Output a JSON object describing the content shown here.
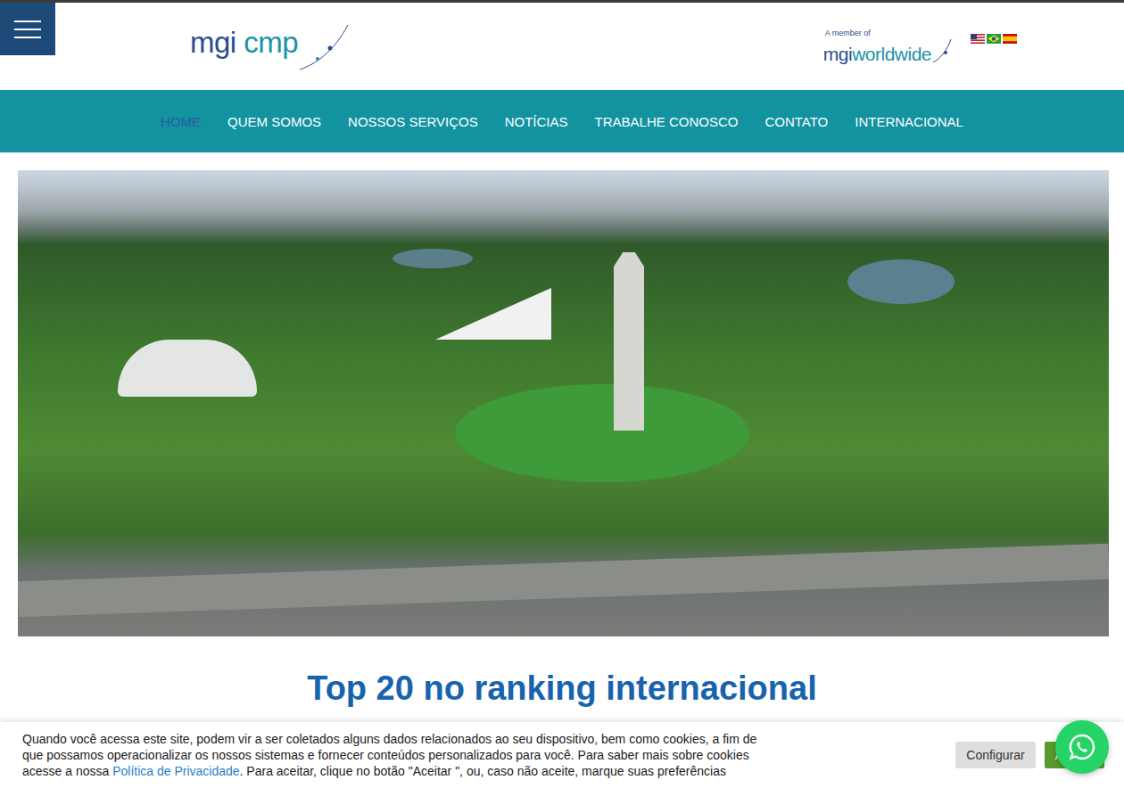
{
  "logo": {
    "part1": "mgi",
    "part2": "cmp"
  },
  "member": {
    "caption": "A member of",
    "part1": "mgi",
    "part2": "worldwide"
  },
  "nav": [
    {
      "label": "HOME",
      "selected": true
    },
    {
      "label": "QUEM SOMOS",
      "selected": false
    },
    {
      "label": "NOSSOS SERVIÇOS",
      "selected": false
    },
    {
      "label": "NOTÍCIAS",
      "selected": false
    },
    {
      "label": "TRABALHE CONOSCO",
      "selected": false
    },
    {
      "label": "CONTATO",
      "selected": false
    },
    {
      "label": "INTERNACIONAL",
      "selected": false
    }
  ],
  "heading": "Top 20 no ranking internacional",
  "cookie": {
    "text_before": "Quando você acessa este site, podem vir a ser coletados alguns dados relacionados ao seu dispositivo, bem como cookies, a fim de que possamos operacionalizar os nossos sistemas e fornecer conteúdos personalizados para você. Para saber mais sobre cookies acesse a nossa ",
    "link": "Política de Privacidade",
    "text_after": ". Para aceitar, clique no botão \"Aceitar \", ou, caso não aceite, marque suas preferências",
    "configure": "Configurar",
    "accept": "A"
  }
}
